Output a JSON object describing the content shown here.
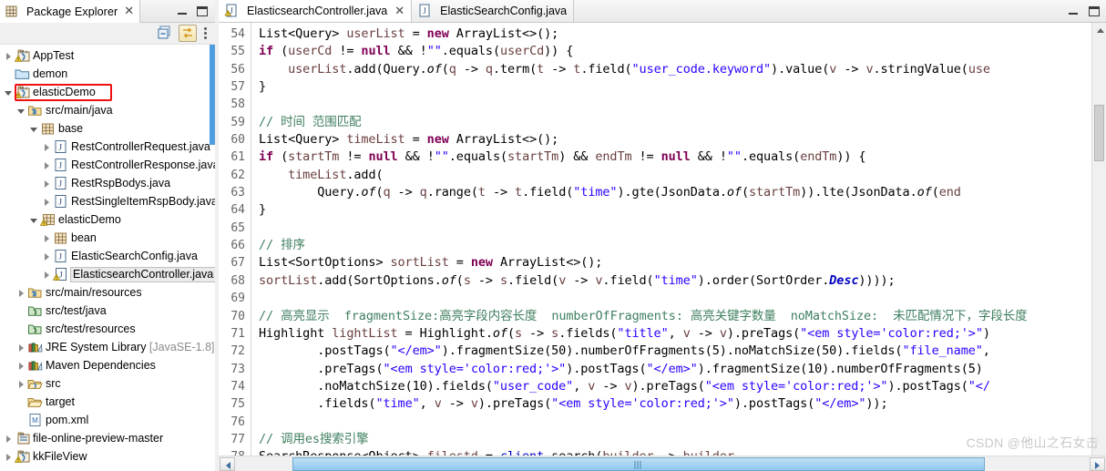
{
  "explorer": {
    "tab_title": "Package Explorer",
    "tab_close": "✕",
    "toolbar": {
      "collapse_all": "collapse-all",
      "link_with_editor": "link-with-editor",
      "view_menu": "view-menu"
    },
    "tree": [
      {
        "label": "AppTest",
        "indent": 0,
        "arrow": "closed",
        "icon": "java-project-warning",
        "selected": false
      },
      {
        "label": "demon",
        "indent": 0,
        "arrow": "none",
        "icon": "folder-closed",
        "selected": false
      },
      {
        "label": "elasticDemo",
        "indent": 0,
        "arrow": "open",
        "icon": "java-project-warning",
        "selected": false,
        "highlight": true
      },
      {
        "label": "src/main/java",
        "indent": 1,
        "arrow": "open",
        "icon": "package-root",
        "selected": false
      },
      {
        "label": "base",
        "indent": 2,
        "arrow": "open",
        "icon": "package",
        "selected": false
      },
      {
        "label": "RestControllerRequest.java",
        "indent": 3,
        "arrow": "closed",
        "icon": "java-file",
        "selected": false
      },
      {
        "label": "RestControllerResponse.java",
        "indent": 3,
        "arrow": "closed",
        "icon": "java-file",
        "selected": false
      },
      {
        "label": "RestRspBodys.java",
        "indent": 3,
        "arrow": "closed",
        "icon": "java-file",
        "selected": false
      },
      {
        "label": "RestSingleItemRspBody.java",
        "indent": 3,
        "arrow": "closed",
        "icon": "java-file",
        "selected": false
      },
      {
        "label": "elasticDemo",
        "indent": 2,
        "arrow": "open",
        "icon": "package-warning",
        "selected": false
      },
      {
        "label": "bean",
        "indent": 3,
        "arrow": "closed",
        "icon": "package",
        "selected": false
      },
      {
        "label": "ElasticSearchConfig.java",
        "indent": 3,
        "arrow": "closed",
        "icon": "java-file",
        "selected": false
      },
      {
        "label": "ElasticsearchController.java",
        "indent": 3,
        "arrow": "closed",
        "icon": "java-file-warning",
        "selected": true
      },
      {
        "label": "src/main/resources",
        "indent": 1,
        "arrow": "closed",
        "icon": "package-root",
        "selected": false
      },
      {
        "label": "src/test/java",
        "indent": 1,
        "arrow": "none",
        "icon": "source-folder",
        "selected": false
      },
      {
        "label": "src/test/resources",
        "indent": 1,
        "arrow": "none",
        "icon": "source-folder",
        "selected": false
      },
      {
        "label": "JRE System Library",
        "indent": 1,
        "arrow": "closed",
        "icon": "library",
        "selected": false,
        "suffix": "[JavaSE-1.8]"
      },
      {
        "label": "Maven Dependencies",
        "indent": 1,
        "arrow": "closed",
        "icon": "library",
        "selected": false
      },
      {
        "label": "src",
        "indent": 1,
        "arrow": "closed",
        "icon": "folder-java",
        "selected": false
      },
      {
        "label": "target",
        "indent": 1,
        "arrow": "none",
        "icon": "folder-open",
        "selected": false
      },
      {
        "label": "pom.xml",
        "indent": 1,
        "arrow": "none",
        "icon": "maven-pom",
        "selected": false
      },
      {
        "label": "file-online-preview-master",
        "indent": 0,
        "arrow": "closed",
        "icon": "project",
        "selected": false
      },
      {
        "label": "kkFileView",
        "indent": 0,
        "arrow": "closed",
        "icon": "java-project-warning",
        "selected": false
      }
    ]
  },
  "editor": {
    "tabs": [
      {
        "label": "ElasticsearchController.java",
        "active": true,
        "icon": "java-file-warning",
        "closable": true,
        "close": "✕"
      },
      {
        "label": "ElasticSearchConfig.java",
        "active": false,
        "icon": "java-file",
        "closable": false,
        "close": ""
      }
    ],
    "minimize_label": "minimize",
    "maximize_label": "maximize",
    "first_line_number": 54,
    "lines": [
      {
        "n": 54,
        "indent": 0,
        "tokens": [
          {
            "t": "List<Query> ",
            "c": "typ"
          },
          {
            "t": "userList",
            "c": "loc"
          },
          {
            "t": " = ",
            "c": "typ"
          },
          {
            "t": "new",
            "c": "kw"
          },
          {
            "t": " ArrayList<>();",
            "c": "typ"
          }
        ]
      },
      {
        "n": 55,
        "indent": 0,
        "tokens": [
          {
            "t": "if",
            "c": "kw"
          },
          {
            "t": " (",
            "c": "typ"
          },
          {
            "t": "userCd",
            "c": "loc"
          },
          {
            "t": " != ",
            "c": "typ"
          },
          {
            "t": "null",
            "c": "kw"
          },
          {
            "t": " && !",
            "c": "typ"
          },
          {
            "t": "\"\"",
            "c": "str"
          },
          {
            "t": ".equals(",
            "c": "typ"
          },
          {
            "t": "userCd",
            "c": "loc"
          },
          {
            "t": ")) {",
            "c": "typ"
          }
        ]
      },
      {
        "n": 56,
        "indent": 1,
        "tokens": [
          {
            "t": "userList",
            "c": "loc"
          },
          {
            "t": ".add(Query.",
            "c": "typ"
          },
          {
            "t": "of",
            "c": "mth"
          },
          {
            "t": "(",
            "c": "typ"
          },
          {
            "t": "q",
            "c": "loc"
          },
          {
            "t": " -> ",
            "c": "typ"
          },
          {
            "t": "q",
            "c": "loc"
          },
          {
            "t": ".term(",
            "c": "typ"
          },
          {
            "t": "t",
            "c": "loc"
          },
          {
            "t": " -> ",
            "c": "typ"
          },
          {
            "t": "t",
            "c": "loc"
          },
          {
            "t": ".field(",
            "c": "typ"
          },
          {
            "t": "\"user_code.keyword\"",
            "c": "str"
          },
          {
            "t": ").value(",
            "c": "typ"
          },
          {
            "t": "v",
            "c": "loc"
          },
          {
            "t": " -> ",
            "c": "typ"
          },
          {
            "t": "v",
            "c": "loc"
          },
          {
            "t": ".stringValue(",
            "c": "typ"
          },
          {
            "t": "use",
            "c": "loc"
          }
        ]
      },
      {
        "n": 57,
        "indent": 0,
        "tokens": [
          {
            "t": "}",
            "c": "typ"
          }
        ]
      },
      {
        "n": 58,
        "indent": 0,
        "tokens": []
      },
      {
        "n": 59,
        "indent": 0,
        "tokens": [
          {
            "t": "// 时间 范围匹配",
            "c": "cmt"
          }
        ]
      },
      {
        "n": 60,
        "indent": 0,
        "tokens": [
          {
            "t": "List<Query> ",
            "c": "typ"
          },
          {
            "t": "timeList",
            "c": "loc"
          },
          {
            "t": " = ",
            "c": "typ"
          },
          {
            "t": "new",
            "c": "kw"
          },
          {
            "t": " ArrayList<>();",
            "c": "typ"
          }
        ]
      },
      {
        "n": 61,
        "indent": 0,
        "tokens": [
          {
            "t": "if",
            "c": "kw"
          },
          {
            "t": " (",
            "c": "typ"
          },
          {
            "t": "startTm",
            "c": "loc"
          },
          {
            "t": " != ",
            "c": "typ"
          },
          {
            "t": "null",
            "c": "kw"
          },
          {
            "t": " && !",
            "c": "typ"
          },
          {
            "t": "\"\"",
            "c": "str"
          },
          {
            "t": ".equals(",
            "c": "typ"
          },
          {
            "t": "startTm",
            "c": "loc"
          },
          {
            "t": ") && ",
            "c": "typ"
          },
          {
            "t": "endTm",
            "c": "loc"
          },
          {
            "t": " != ",
            "c": "typ"
          },
          {
            "t": "null",
            "c": "kw"
          },
          {
            "t": " && !",
            "c": "typ"
          },
          {
            "t": "\"\"",
            "c": "str"
          },
          {
            "t": ".equals(",
            "c": "typ"
          },
          {
            "t": "endTm",
            "c": "loc"
          },
          {
            "t": ")) {",
            "c": "typ"
          }
        ]
      },
      {
        "n": 62,
        "indent": 1,
        "tokens": [
          {
            "t": "timeList",
            "c": "loc"
          },
          {
            "t": ".add(",
            "c": "typ"
          }
        ]
      },
      {
        "n": 63,
        "indent": 2,
        "tokens": [
          {
            "t": "Query.",
            "c": "typ"
          },
          {
            "t": "of",
            "c": "mth"
          },
          {
            "t": "(",
            "c": "typ"
          },
          {
            "t": "q",
            "c": "loc"
          },
          {
            "t": " -> ",
            "c": "typ"
          },
          {
            "t": "q",
            "c": "loc"
          },
          {
            "t": ".range(",
            "c": "typ"
          },
          {
            "t": "t",
            "c": "loc"
          },
          {
            "t": " -> ",
            "c": "typ"
          },
          {
            "t": "t",
            "c": "loc"
          },
          {
            "t": ".field(",
            "c": "typ"
          },
          {
            "t": "\"time\"",
            "c": "str"
          },
          {
            "t": ").gte(JsonData.",
            "c": "typ"
          },
          {
            "t": "of",
            "c": "mth"
          },
          {
            "t": "(",
            "c": "typ"
          },
          {
            "t": "startTm",
            "c": "loc"
          },
          {
            "t": ")).lte(JsonData.",
            "c": "typ"
          },
          {
            "t": "of",
            "c": "mth"
          },
          {
            "t": "(",
            "c": "typ"
          },
          {
            "t": "end",
            "c": "loc"
          }
        ]
      },
      {
        "n": 64,
        "indent": 0,
        "tokens": [
          {
            "t": "}",
            "c": "typ"
          }
        ]
      },
      {
        "n": 65,
        "indent": 0,
        "tokens": []
      },
      {
        "n": 66,
        "indent": 0,
        "tokens": [
          {
            "t": "// 排序",
            "c": "cmt"
          }
        ]
      },
      {
        "n": 67,
        "indent": 0,
        "tokens": [
          {
            "t": "List<SortOptions> ",
            "c": "typ"
          },
          {
            "t": "sortList",
            "c": "loc"
          },
          {
            "t": " = ",
            "c": "typ"
          },
          {
            "t": "new",
            "c": "kw"
          },
          {
            "t": " ArrayList<>();",
            "c": "typ"
          }
        ]
      },
      {
        "n": 68,
        "indent": 0,
        "tokens": [
          {
            "t": "sortList",
            "c": "loc"
          },
          {
            "t": ".add(SortOptions.",
            "c": "typ"
          },
          {
            "t": "of",
            "c": "mth"
          },
          {
            "t": "(",
            "c": "typ"
          },
          {
            "t": "s",
            "c": "loc"
          },
          {
            "t": " -> ",
            "c": "typ"
          },
          {
            "t": "s",
            "c": "loc"
          },
          {
            "t": ".field(",
            "c": "typ"
          },
          {
            "t": "v",
            "c": "loc"
          },
          {
            "t": " -> ",
            "c": "typ"
          },
          {
            "t": "v",
            "c": "loc"
          },
          {
            "t": ".field(",
            "c": "typ"
          },
          {
            "t": "\"time\"",
            "c": "str"
          },
          {
            "t": ").order(SortOrder.",
            "c": "typ"
          },
          {
            "t": "Desc",
            "c": "sfld"
          },
          {
            "t": "))));",
            "c": "typ"
          }
        ]
      },
      {
        "n": 69,
        "indent": 0,
        "tokens": []
      },
      {
        "n": 70,
        "indent": 0,
        "tokens": [
          {
            "t": "// 高亮显示  fragmentSize:高亮字段内容长度  numberOfFragments: 高亮关键字数量  noMatchSize:  未匹配情况下，字段长度",
            "c": "cmt"
          }
        ]
      },
      {
        "n": 71,
        "indent": 0,
        "tokens": [
          {
            "t": "Highlight ",
            "c": "typ"
          },
          {
            "t": "lightList",
            "c": "loc"
          },
          {
            "t": " = Highlight.",
            "c": "typ"
          },
          {
            "t": "of",
            "c": "mth"
          },
          {
            "t": "(",
            "c": "typ"
          },
          {
            "t": "s",
            "c": "loc"
          },
          {
            "t": " -> ",
            "c": "typ"
          },
          {
            "t": "s",
            "c": "loc"
          },
          {
            "t": ".fields(",
            "c": "typ"
          },
          {
            "t": "\"title\"",
            "c": "str"
          },
          {
            "t": ", ",
            "c": "typ"
          },
          {
            "t": "v",
            "c": "loc"
          },
          {
            "t": " -> ",
            "c": "typ"
          },
          {
            "t": "v",
            "c": "loc"
          },
          {
            "t": ").preTags(",
            "c": "typ"
          },
          {
            "t": "\"<em style='color:red;'>\"",
            "c": "str"
          },
          {
            "t": ")",
            "c": "typ"
          }
        ]
      },
      {
        "n": 72,
        "indent": 2,
        "tokens": [
          {
            "t": ".postTags(",
            "c": "typ"
          },
          {
            "t": "\"</em>\"",
            "c": "str"
          },
          {
            "t": ").fragmentSize(50).numberOfFragments(5).noMatchSize(50).fields(",
            "c": "typ"
          },
          {
            "t": "\"file_name\"",
            "c": "str"
          },
          {
            "t": ",",
            "c": "typ"
          }
        ]
      },
      {
        "n": 73,
        "indent": 2,
        "tokens": [
          {
            "t": ".preTags(",
            "c": "typ"
          },
          {
            "t": "\"<em style='color:red;'>\"",
            "c": "str"
          },
          {
            "t": ").postTags(",
            "c": "typ"
          },
          {
            "t": "\"</em>\"",
            "c": "str"
          },
          {
            "t": ").fragmentSize(10).numberOfFragments(5)",
            "c": "typ"
          }
        ]
      },
      {
        "n": 74,
        "indent": 2,
        "tokens": [
          {
            "t": ".noMatchSize(10).fields(",
            "c": "typ"
          },
          {
            "t": "\"user_code\"",
            "c": "str"
          },
          {
            "t": ", ",
            "c": "typ"
          },
          {
            "t": "v",
            "c": "loc"
          },
          {
            "t": " -> ",
            "c": "typ"
          },
          {
            "t": "v",
            "c": "loc"
          },
          {
            "t": ").preTags(",
            "c": "typ"
          },
          {
            "t": "\"<em style='color:red;'>\"",
            "c": "str"
          },
          {
            "t": ").postTags(",
            "c": "typ"
          },
          {
            "t": "\"</",
            "c": "str"
          }
        ]
      },
      {
        "n": 75,
        "indent": 2,
        "tokens": [
          {
            "t": ".fields(",
            "c": "typ"
          },
          {
            "t": "\"time\"",
            "c": "str"
          },
          {
            "t": ", ",
            "c": "typ"
          },
          {
            "t": "v",
            "c": "loc"
          },
          {
            "t": " -> ",
            "c": "typ"
          },
          {
            "t": "v",
            "c": "loc"
          },
          {
            "t": ").preTags(",
            "c": "typ"
          },
          {
            "t": "\"<em style='color:red;'>\"",
            "c": "str"
          },
          {
            "t": ").postTags(",
            "c": "typ"
          },
          {
            "t": "\"</em>\"",
            "c": "str"
          },
          {
            "t": "));",
            "c": "typ"
          }
        ]
      },
      {
        "n": 76,
        "indent": 0,
        "tokens": []
      },
      {
        "n": 77,
        "indent": 0,
        "tokens": [
          {
            "t": "// 调用es搜索引擎",
            "c": "cmt"
          }
        ]
      },
      {
        "n": 78,
        "indent": 0,
        "tokens": [
          {
            "t": "SearchResponse<Object> ",
            "c": "typ"
          },
          {
            "t": "filestd",
            "c": "loc"
          },
          {
            "t": " = ",
            "c": "typ"
          },
          {
            "t": "client",
            "c": "fld"
          },
          {
            "t": ".search(",
            "c": "typ"
          },
          {
            "t": "builder",
            "c": "loc"
          },
          {
            "t": " -> ",
            "c": "typ"
          },
          {
            "t": "builder",
            "c": "loc"
          }
        ]
      }
    ]
  },
  "scrollbars": {
    "h_left": "scroll-left",
    "h_right": "scroll-right",
    "v_up": "scroll-up",
    "v_down": "scroll-down"
  },
  "watermark": "CSDN @他山之石女击"
}
